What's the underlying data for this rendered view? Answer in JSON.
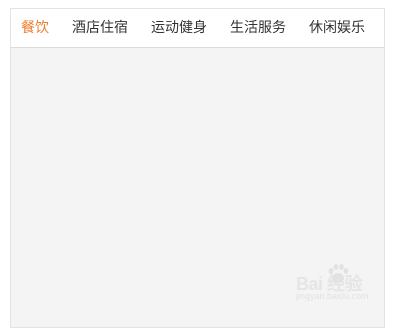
{
  "tabs": [
    {
      "label": "餐饮",
      "active": true
    },
    {
      "label": "酒店住宿",
      "active": false
    },
    {
      "label": "运动健身",
      "active": false
    },
    {
      "label": "生活服务",
      "active": false
    },
    {
      "label": "休闲娱乐",
      "active": false
    }
  ],
  "colors": {
    "active_tab": "#ee7b2c",
    "tab_text": "#333333",
    "content_bg": "#f4f4f4"
  },
  "watermark": {
    "brand": "Bai 经验",
    "url": "jingyan.baidu.com",
    "icon": "baidu-paw-icon"
  }
}
